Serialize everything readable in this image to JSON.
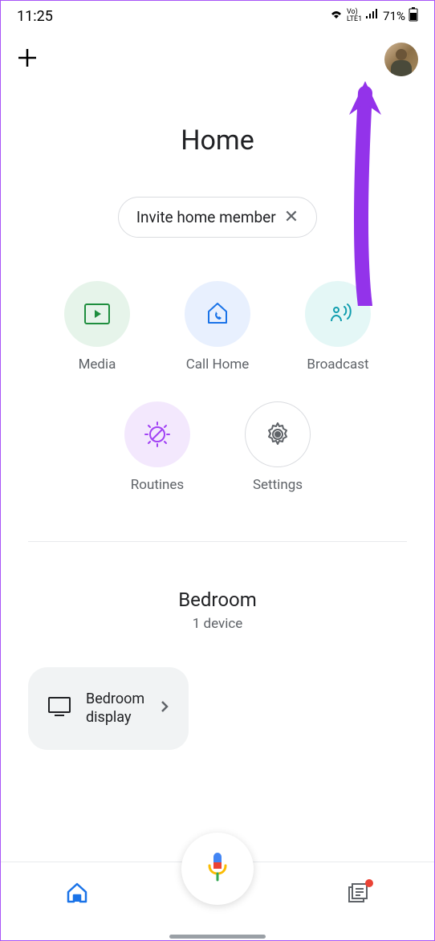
{
  "status": {
    "time": "11:25",
    "battery": "71%"
  },
  "title": "Home",
  "chip": "Invite home member",
  "actions": {
    "media": "Media",
    "call": "Call Home",
    "broadcast": "Broadcast",
    "routines": "Routines",
    "settings": "Settings"
  },
  "room": {
    "name": "Bedroom",
    "sub": "1 device",
    "device": "Bedroom display"
  }
}
